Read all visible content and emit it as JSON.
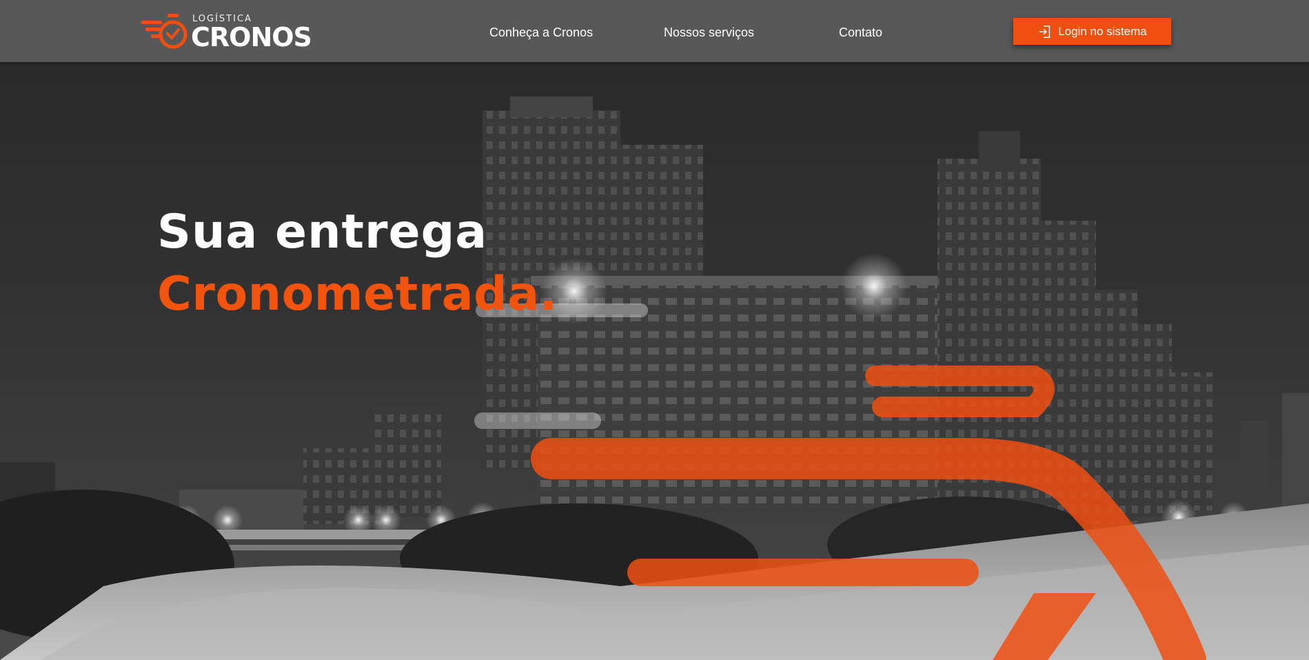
{
  "brand": {
    "small_text": "LOGÍSTICA",
    "name": "CRONOS",
    "accent_color": "#ef4f11"
  },
  "nav": {
    "links": [
      {
        "label": "Conheça a Cronos"
      },
      {
        "label": "Nossos serviços"
      },
      {
        "label": "Contato"
      }
    ],
    "login_button": {
      "label": "Login no sistema",
      "icon": "login-icon"
    }
  },
  "hero": {
    "headline_line1": "Sua entrega",
    "headline_line2": "Cronometrada.",
    "background": "night-city-highway-photo"
  }
}
